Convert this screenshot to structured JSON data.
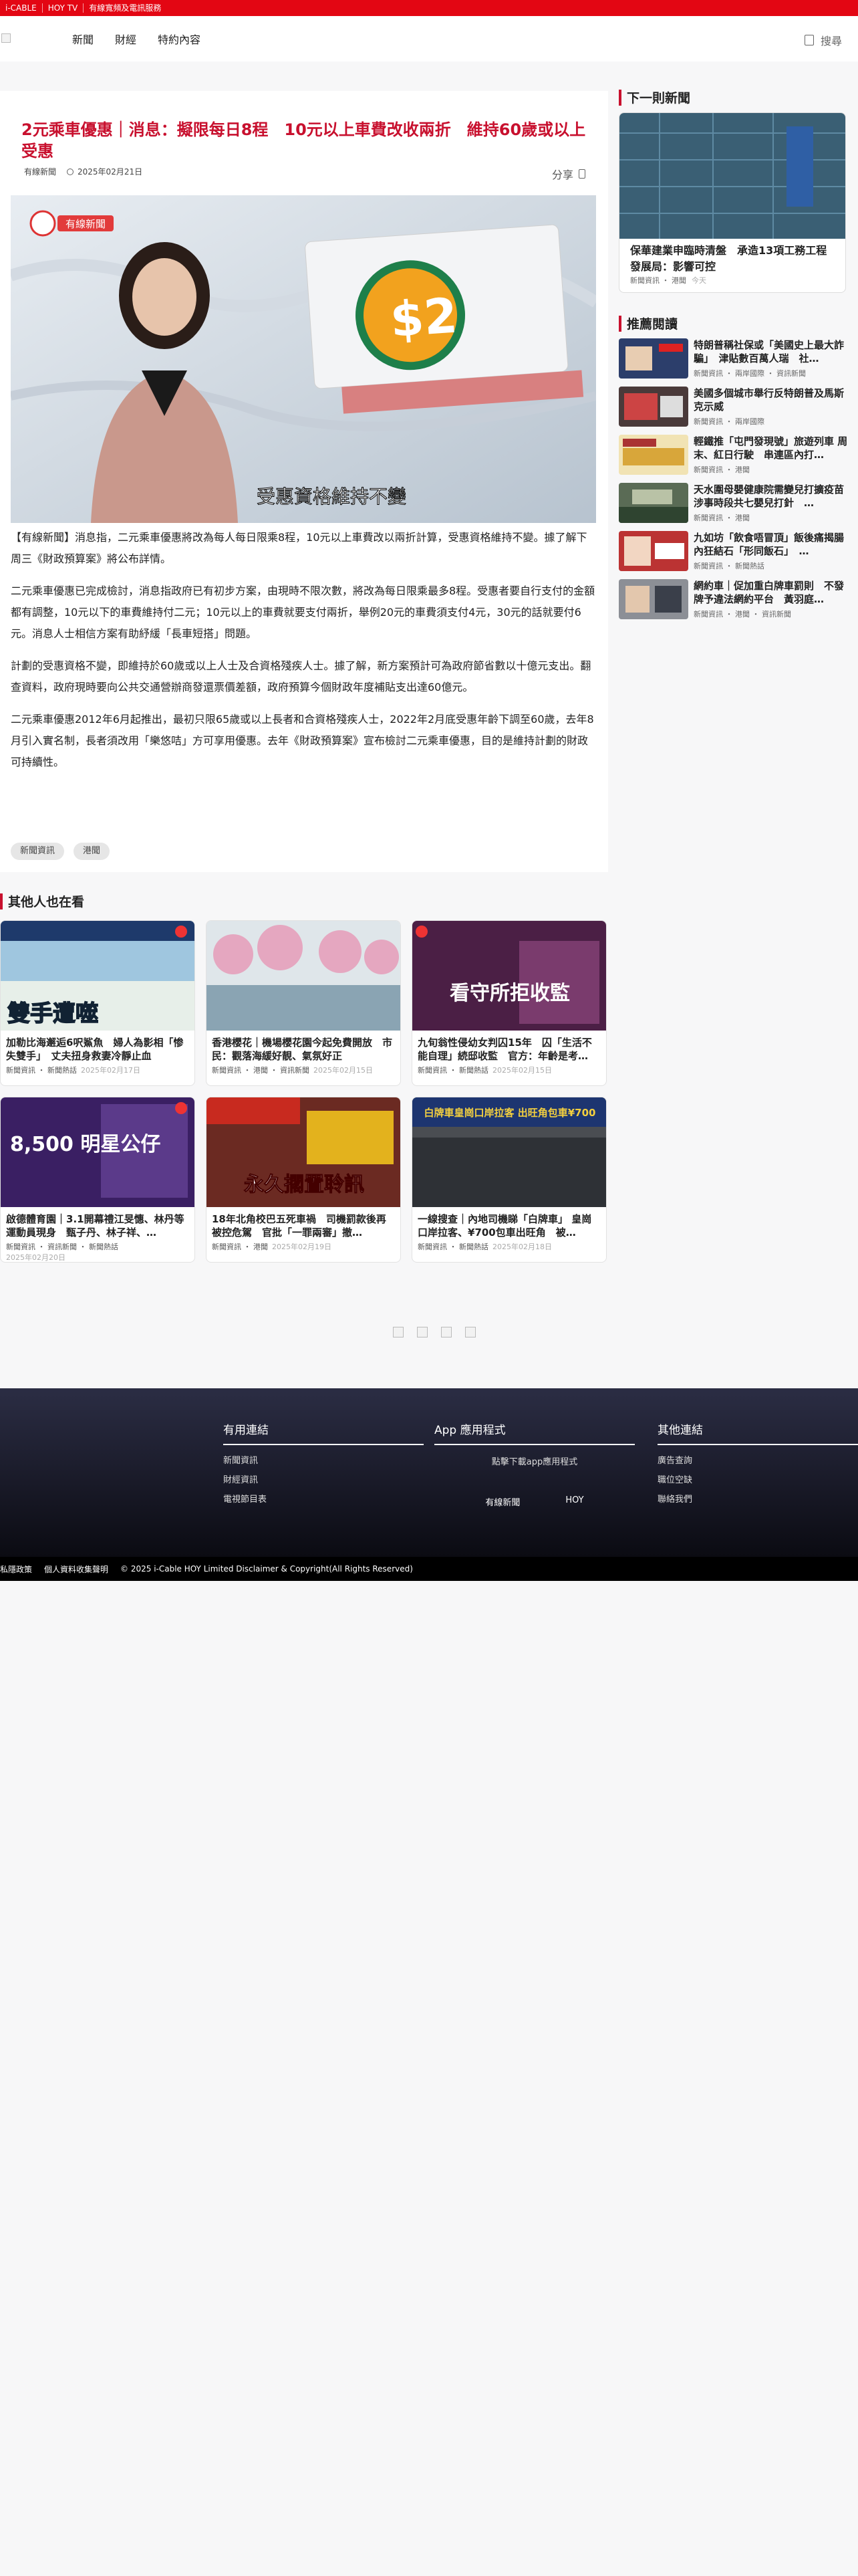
{
  "topstrip": {
    "items": [
      "i-CABLE",
      "HOY TV",
      "有線寬頻及電訊服務"
    ]
  },
  "header": {
    "nav": [
      "新聞",
      "財經",
      "特約內容"
    ],
    "search_label": "搜尋"
  },
  "article": {
    "title": "2元乘車優惠｜消息：擬限每日8程　10元以上車費改收兩折　維持60歲或以上受惠",
    "source": "有線新聞",
    "date": "2025年02月21日",
    "share_label": "分享",
    "hero_caption": "受惠資格維持不變",
    "hero_logo": "有線新聞",
    "paragraphs": [
      "【有線新聞】消息指，二元乘車優惠將改為每人每日限乘8程，10元以上車費改以兩折計算，受惠資格維持不變。據了解下周三《財政預算案》將公布詳情。",
      "二元乘車優惠已完成檢討，消息指政府已有初步方案，由現時不限次數，將改為每日限乘最多8程。受惠者要自行支付的金額都有調整，10元以下的車費維持付二元；10元以上的車費就要支付兩折，舉例20元的車費須支付4元，30元的話就要付6元。消息人士相信方案有助紓緩「長車短搭」問題。",
      "計劃的受惠資格不變，即維持於60歲或以上人士及合資格殘疾人士。據了解，新方案預計可為政府節省數以十億元支出。翻查資料，政府現時要向公共交通營辦商發還票價差額，政府預算今個財政年度補貼支出達60億元。",
      "二元乘車優惠2012年6月起推出，最初只限65歲或以上長者和合資格殘疾人士，2022年2月底受惠年齡下調至60歲，去年8月引入實名制，長者須改用「樂悠咭」方可享用優惠。去年《財政預算案》宣布檢討二元乘車優惠，目的是維持計劃的財政可持續性。"
    ],
    "tags": [
      "新聞資訊",
      "港聞"
    ]
  },
  "sidebar": {
    "next_title": "下一則新聞",
    "next": {
      "title": "保華建業申臨時清盤　承造13項工務工程 發展局：影響可控",
      "cats": "新聞資訊 ・ 港聞",
      "date": "今天"
    },
    "rec_title": "推薦閱讀",
    "recommended": [
      {
        "title": "特朗普稱社保或「美國史上最大詐騙」　津貼數百萬人瑞　社…",
        "cats": "新聞資訊 ・ 兩岸國際 ・ 資訊新聞"
      },
      {
        "title": "美國多個城市舉行反特朗普及馬斯克示威",
        "cats": "新聞資訊 ・ 兩岸國際"
      },
      {
        "title": "輕鐵推「屯門發現號」旅遊列車 周末、紅日行駛　串連區內打…",
        "cats": "新聞資訊 ・ 港聞"
      },
      {
        "title": "天水圍母嬰健康院需變兒打擴疫苗　涉事時段共七嬰兒打針　…",
        "cats": "新聞資訊 ・ 港聞"
      },
      {
        "title": "九如坊「飲食唔冒頂」飯後痛揭腸內狂結石「形同飯石」　…",
        "cats": "新聞資訊 ・ 新聞熱話"
      },
      {
        "title": "網約車｜促加重白牌車罰則　不發牌予違法網約平台　黃羽庭…",
        "cats": "新聞資訊 ・ 港聞 ・ 資訊新聞"
      }
    ]
  },
  "others": {
    "title": "其他人也在看",
    "cards": [
      {
        "title": "加勒比海邂逅6呎鯊魚　婦人為影相「惨失雙手」　丈夫扭身救妻冷靜止血",
        "cats": "新聞資訊 ・ 新聞熱話",
        "date": "2025年02月17日",
        "img_text": "雙手遭噬"
      },
      {
        "title": "香港櫻花｜機場櫻花園今起免費開放　市民：觀落海緩好靚、氣氛好正",
        "cats": "新聞資訊 ・ 港聞 ・ 資訊新聞",
        "date": "2025年02月15日",
        "img_text": ""
      },
      {
        "title": "九旬翁性侵幼女判囚15年　囚「生活不能自理」続邸收監　官方：年齡是考…",
        "cats": "新聞資訊 ・ 新聞熱話",
        "date": "2025年02月15日",
        "img_text": "看守所拒收監"
      },
      {
        "title": "啟德體育園｜3.1開幕禮江旻憓、林丹等運動員現身　甄子丹、林子祥、…",
        "cats": "新聞資訊 ・ 資訊新聞 ・ 新聞熱話",
        "date": "2025年02月20日",
        "img_text": "8,500 明星公仔"
      },
      {
        "title": "18年北角校巴五死車禍　司機罰款後再被控危駕　官批「一罪兩審」撤…",
        "cats": "新聞資訊 ・ 港聞",
        "date": "2025年02月19日",
        "img_text": "永久擱置聆訊"
      },
      {
        "title": "一線搜查｜內地司機睇「白牌車」 皇崗口岸拉客、¥700包車出旺角　被…",
        "cats": "新聞資訊 ・ 新聞熱話",
        "date": "2025年02月18日",
        "img_text": "白牌車皇崗口岸拉客 出旺角包車¥700"
      }
    ]
  },
  "footer": {
    "useful_title": "有用連結",
    "useful_links": [
      "新聞資訊",
      "財經資訊",
      "電視節目表"
    ],
    "app_title": "App 應用程式",
    "app_sub": "點擊下載app應用程式",
    "apps": [
      "有線新聞",
      "HOY"
    ],
    "other_title": "其他連結",
    "other_links": [
      "廣告查詢",
      "職位空缺",
      "聯絡我們"
    ],
    "bottom": [
      "私隱政策",
      "個人資料收集聲明",
      "© 2025 i-Cable HOY Limited Disclaimer & Copyright(All Rights Reserved)"
    ]
  },
  "colors": {
    "brand_red": "#e30613",
    "title_red": "#c8102e",
    "footer_dark": "#1a1b2b"
  }
}
